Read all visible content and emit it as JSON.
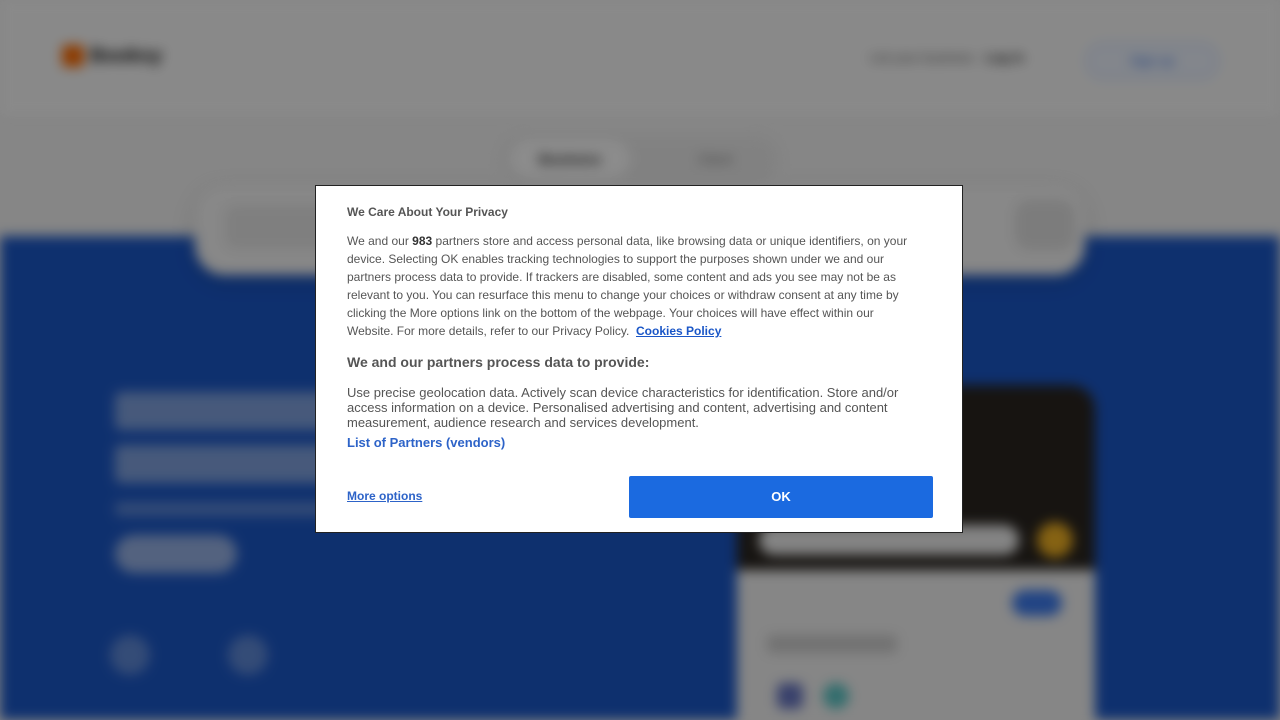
{
  "site": {
    "logo_text": "Booksy",
    "nav_link_1": "List your business",
    "nav_link_2": "Log in",
    "nav_cta": "Sign up",
    "tabs": [
      "Business",
      "Client"
    ]
  },
  "consent": {
    "title": "We Care About Your Privacy",
    "intro_before_count": "We and our ",
    "partner_count": "983",
    "intro_after_count": " partners store and access personal data, like browsing data or unique identifiers, on your device. Selecting OK enables tracking technologies to support the purposes shown under we and our partners process data to provide. If trackers are disabled, some content and ads you see may not be as relevant to you. You can resurface this menu to change your choices or withdraw consent at any time by clicking the More options link on the bottom of the webpage. Your choices will have effect within our Website. For more details, refer to our Privacy Policy.",
    "cookies_policy_link": "Cookies Policy",
    "subheading": "We and our partners process data to provide:",
    "purposes": "Use precise geolocation data. Actively scan device characteristics for identification. Store and/or access information on a device. Personalised advertising and content, advertising and content measurement, audience research and services development.",
    "partners_link": "List of Partners (vendors)",
    "more_options_label": "More options",
    "ok_label": "OK"
  },
  "colors": {
    "primary_blue": "#1b6ae0",
    "hero_blue": "#1b58c9",
    "link_blue": "#2d63c8",
    "brand_orange": "#ff6b00"
  }
}
